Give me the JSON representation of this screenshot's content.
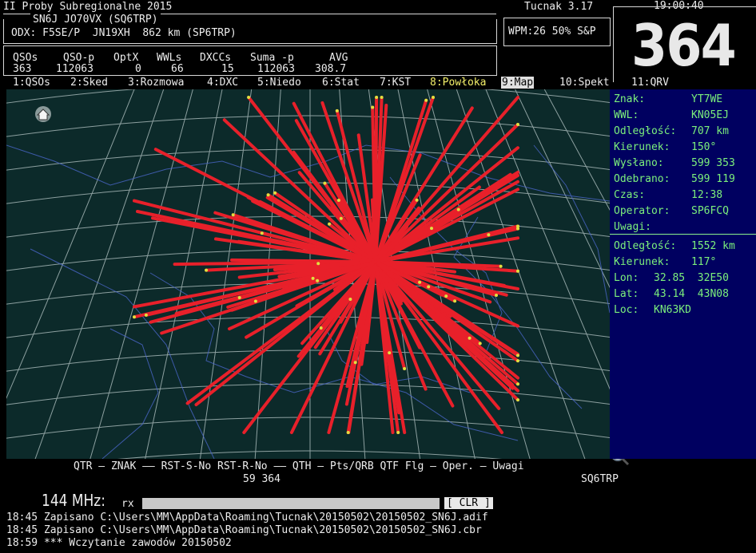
{
  "header": {
    "contest_title": "II Proby Subregionalne 2015",
    "app_title": "Tucnak 3.17",
    "clock": "19:00:40",
    "station": "SN6J JO70VX (SQ6TRP)",
    "odx": "ODX: F5SE/P  JN19XH  862 km (SP6TRP)",
    "cw_status": "WPM:26 50% S&P",
    "qso_count_big": "364"
  },
  "stats": {
    "headers": [
      "QSOs",
      "QSO-p",
      "OptX",
      "WWLs",
      "DXCCs",
      "Suma -p",
      "AVG"
    ],
    "values": [
      "363",
      "112063",
      "0",
      "66",
      "15",
      "112063",
      "308.7"
    ]
  },
  "tabs": [
    {
      "label": "1:QSOs",
      "active": false
    },
    {
      "label": "2:Sked",
      "active": false
    },
    {
      "label": "3:Rozmowa",
      "active": false
    },
    {
      "label": "4:DXC",
      "active": false
    },
    {
      "label": "5:Niedo",
      "active": false
    },
    {
      "label": "6:Stat",
      "active": false
    },
    {
      "label": "7:KST",
      "active": false
    },
    {
      "label": "8:Powłoka",
      "active": false,
      "highlight": true
    },
    {
      "label": "9:Map",
      "active": true
    },
    {
      "label": "10:Spekt",
      "active": false
    },
    {
      "label": "11:QRV",
      "active": false
    }
  ],
  "info": {
    "znak_label": "Znak:",
    "znak": "YT7WE",
    "wwl_label": "WWL:",
    "wwl": "KN05EJ",
    "odl_label": "Odległość:",
    "odl": "707 km",
    "kier_label": "Kierunek:",
    "kier": "150°",
    "wys_label": "Wysłano:",
    "wys": "599 353",
    "odeb_label": "Odebrano:",
    "odeb": "599 119",
    "czas_label": "Czas:",
    "czas": "12:38",
    "oper_label": "Operator:",
    "oper": "SP6FCQ",
    "uwagi_label": "Uwagi:",
    "odl2_label": "Odległość:",
    "odl2": "1552 km",
    "kier2_label": "Kierunek:",
    "kier2": "117°",
    "lon_label": "Lon:",
    "lon": "32.85  32E50",
    "lat_label": "Lat:",
    "lat": "43.14  43N08",
    "loc_label": "Loc:",
    "loc": "KN63KD"
  },
  "columns_line": "QTR — ZNAK —— RST-S-No RST-R-No —— QTH — Pts/QRB QTF Flg — Oper. — Uwagi",
  "entry_values": {
    "rst_exchange": "59 364",
    "operator": "SQ6TRP"
  },
  "band": "144 MHz:",
  "rx_label": "rx",
  "clr_button": "[ CLR ]",
  "log_lines": [
    "18:45 Zapisano C:\\Users\\MM\\AppData\\Roaming\\Tucnak\\20150502\\20150502_SN6J.adif",
    "18:45 Zapisano C:\\Users\\MM\\AppData\\Roaming\\Tucnak\\20150502\\20150502_SN6J.cbr",
    "18:59 *** Wczytanie zawodów 20150502"
  ],
  "icons": {
    "home": "home-icon",
    "zoom_in": "zoom-in-icon",
    "zoom_out": "zoom-out-icon"
  },
  "colors": {
    "qso_lines": "#e8202a",
    "map_bg": "#0c2a2a",
    "info_bg": "#000060",
    "info_text": "#7cf07c",
    "highlight_tab": "#f4f06a"
  }
}
